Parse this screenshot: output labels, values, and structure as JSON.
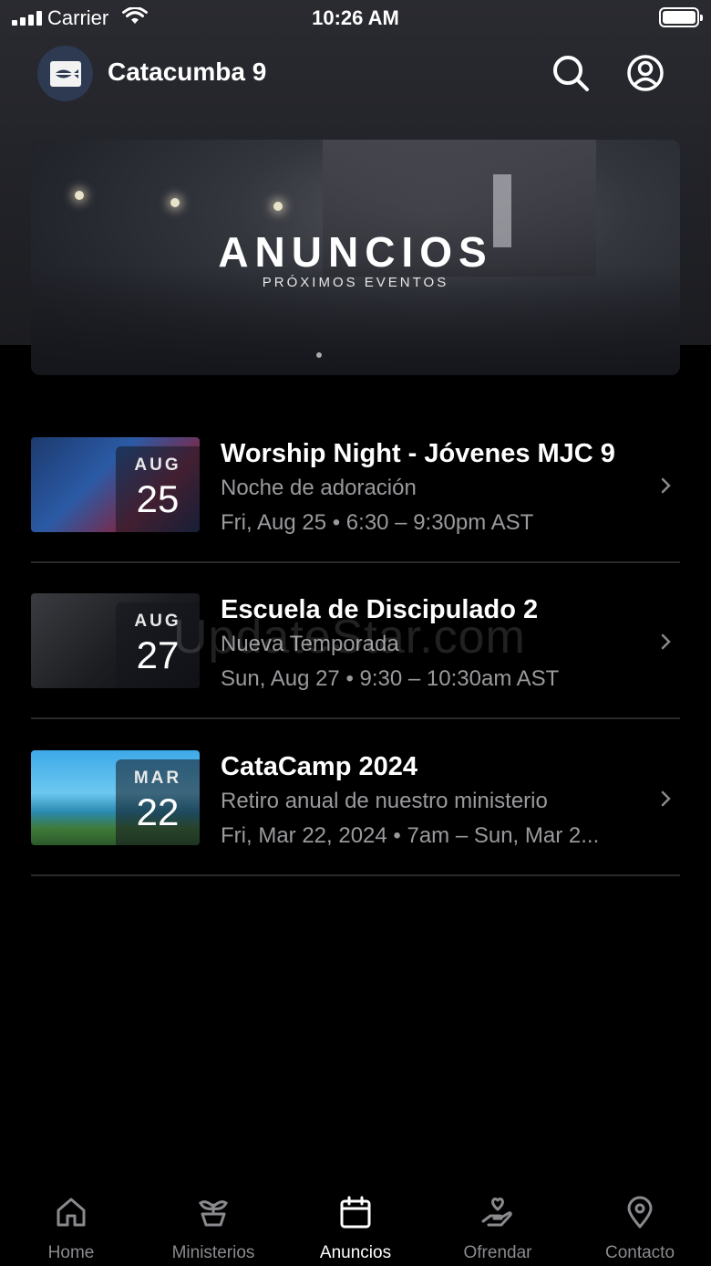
{
  "status_bar": {
    "carrier": "Carrier",
    "time": "10:26 AM"
  },
  "header": {
    "title": "Catacumba 9",
    "logo_icon": "fish-logo-icon",
    "actions": [
      "search-icon",
      "account-icon"
    ]
  },
  "banner": {
    "title": "ANUNCIOS",
    "subtitle": "PRÓXIMOS EVENTOS"
  },
  "events": [
    {
      "title": "Worship Night - Jóvenes MJC 9",
      "subtitle": "Noche de adoración",
      "time": "Fri, Aug 25 • 6:30 – 9:30pm AST",
      "month": "AUG",
      "day": "25"
    },
    {
      "title": "Escuela de Discipulado 2",
      "subtitle": "Nueva Temporada",
      "time": "Sun, Aug 27 • 9:30 – 10:30am AST",
      "month": "AUG",
      "day": "27"
    },
    {
      "title": "CataCamp 2024",
      "subtitle": "Retiro anual de nuestro ministerio",
      "time": "Fri, Mar 22, 2024 • 7am – Sun, Mar 2...",
      "month": "MAR",
      "day": "22"
    }
  ],
  "watermark": "UpdateStar.com",
  "tabs": [
    {
      "label": "Home",
      "icon": "home-icon",
      "active": false
    },
    {
      "label": "Ministerios",
      "icon": "plant-icon",
      "active": false
    },
    {
      "label": "Anuncios",
      "icon": "calendar-icon",
      "active": true
    },
    {
      "label": "Ofrendar",
      "icon": "giving-hand-icon",
      "active": false
    },
    {
      "label": "Contacto",
      "icon": "location-pin-icon",
      "active": false
    }
  ],
  "colors": {
    "background": "#000000",
    "secondary_text": "#9a9a9e",
    "inactive_tab": "#8a8a8e",
    "active_tab": "#ffffff"
  }
}
